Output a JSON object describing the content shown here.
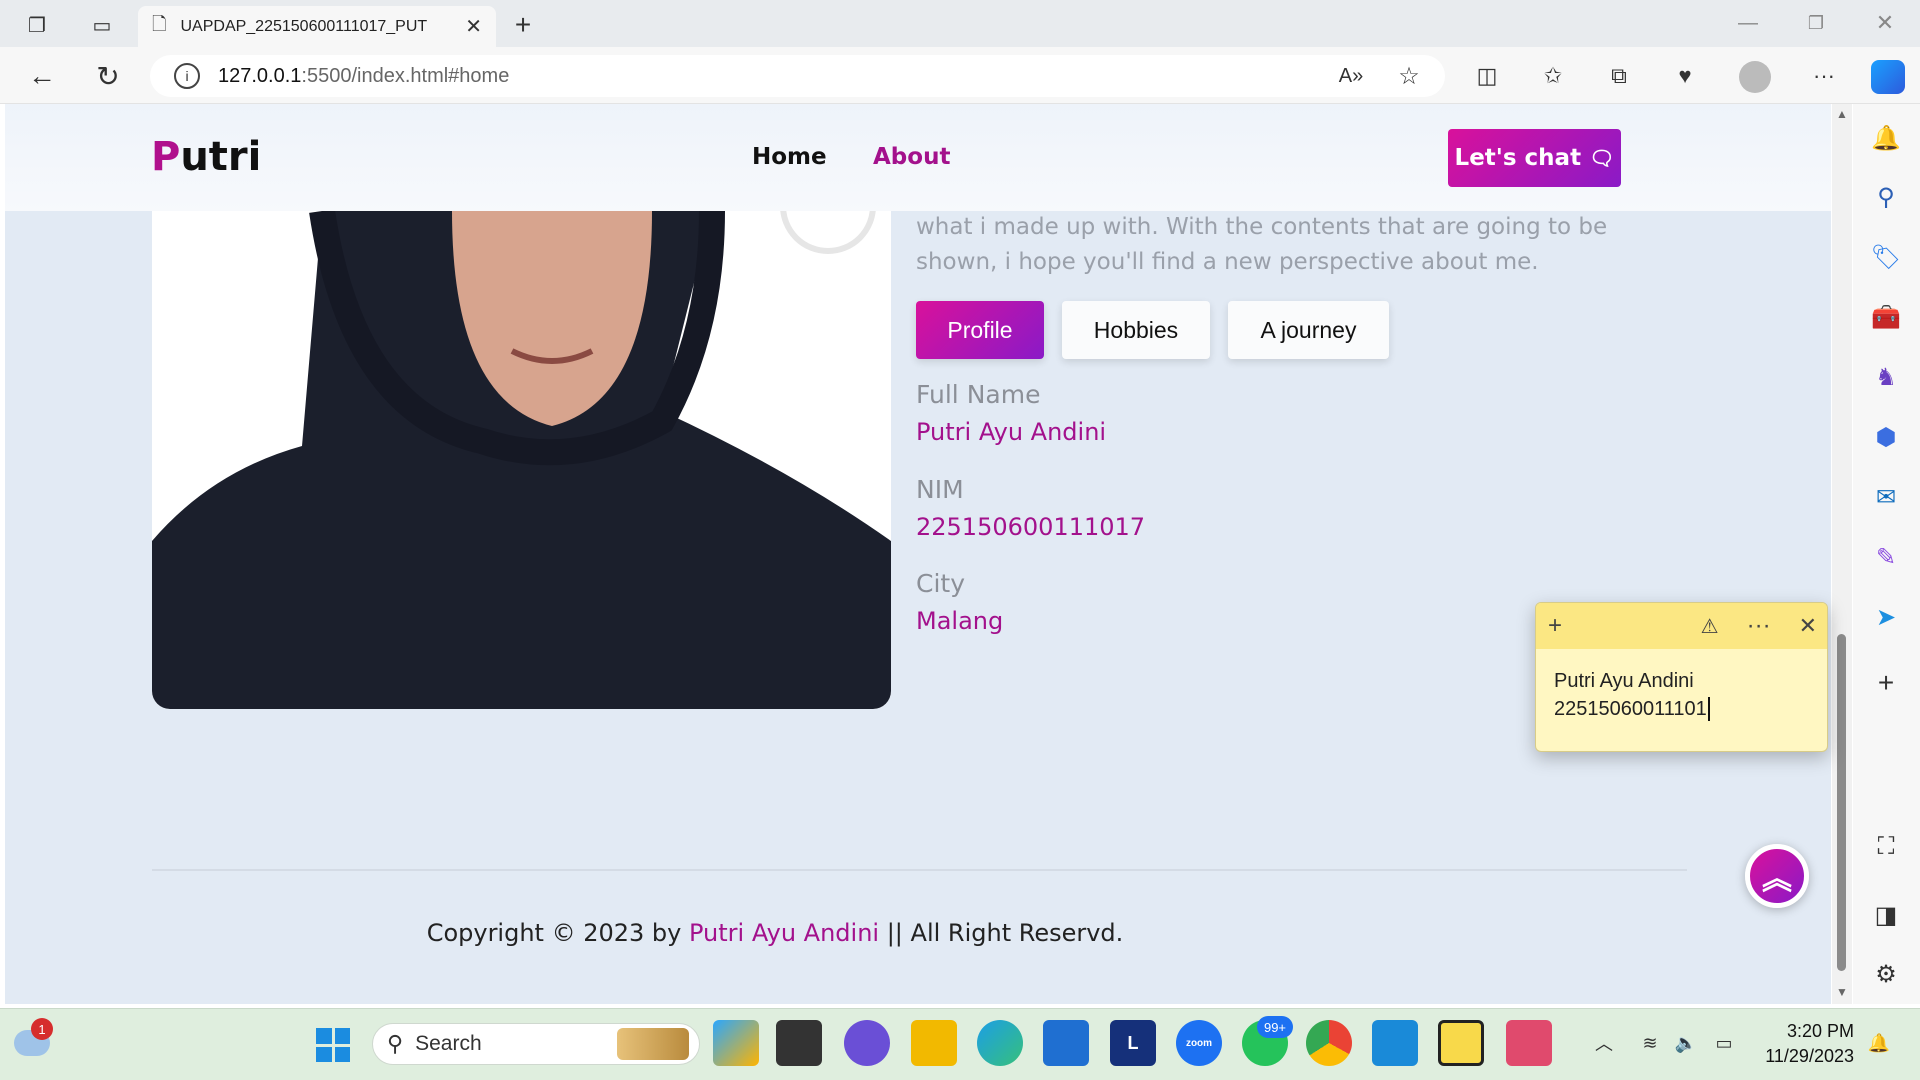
{
  "browser": {
    "tab_title": "UAPDAP_225150600111017_PUT",
    "url_host": "127.0.0.1",
    "url_path": ":5500/index.html#home"
  },
  "site": {
    "logo_first": "P",
    "logo_rest": "utri",
    "nav": [
      {
        "label": "Home"
      },
      {
        "label": "About"
      }
    ],
    "chat_label": "Let's chat",
    "intro_line1": "what i made up with. With the contents that are going to be",
    "intro_line2": "shown, i hope you'll find a new perspective about me.",
    "tabs": [
      {
        "label": "Profile"
      },
      {
        "label": "Hobbies"
      },
      {
        "label": "A journey"
      }
    ],
    "profile": {
      "fullname_label": "Full Name",
      "fullname_value": "Putri Ayu Andini",
      "nim_label": "NIM",
      "nim_value": "225150600111017",
      "city_label": "City",
      "city_value": "Malang"
    },
    "footer_prefix": "Copyright © 2023 by",
    "footer_name": "Putri Ayu Andini",
    "footer_suffix": "|| All Right Reservd."
  },
  "sticky_note": {
    "line1": "Putri Ayu Andini",
    "line2": "22515060011101"
  },
  "taskbar": {
    "weather_badge": "1",
    "search_label": "Search",
    "whatsapp_badge": "99+",
    "time": "3:20 PM",
    "date": "11/29/2023"
  },
  "colors": {
    "accent": "#a3118c",
    "gradient_start": "#d9119b",
    "gradient_end": "#8a1ac7",
    "page_bg": "#e2eaf4"
  }
}
